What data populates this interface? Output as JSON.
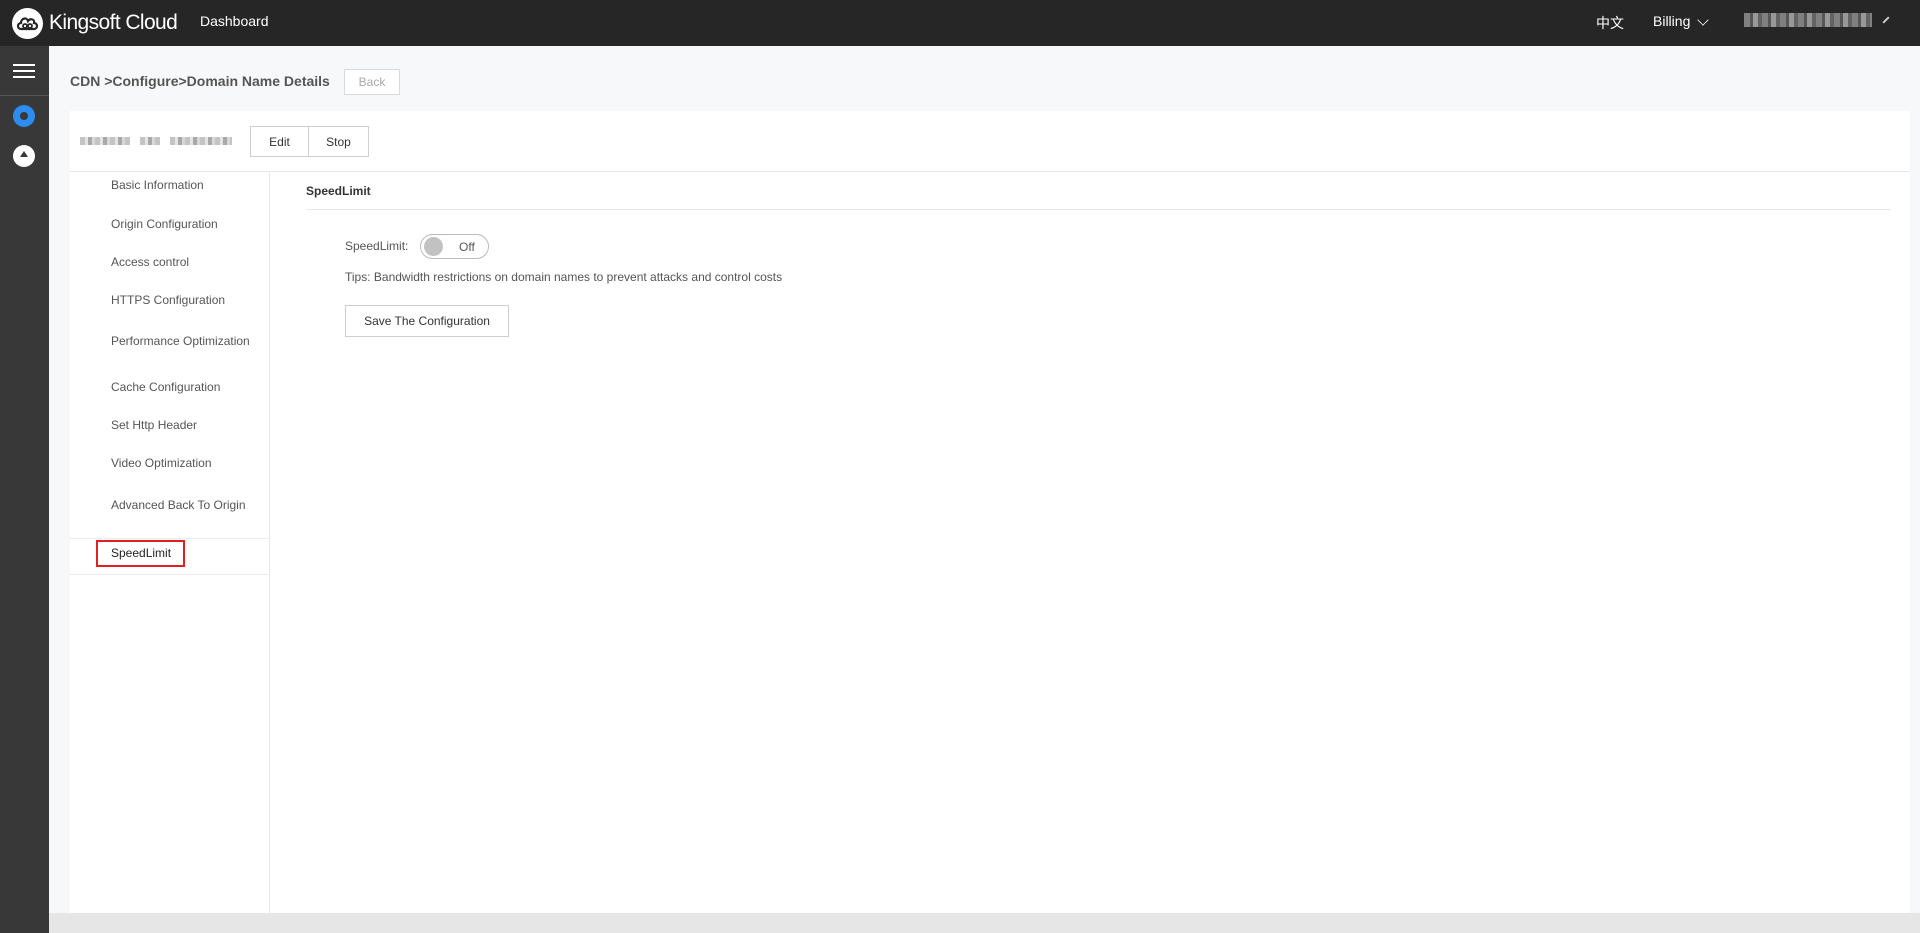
{
  "topbar": {
    "brand": "Kingsoft Cloud",
    "dashboard": "Dashboard",
    "language": "中文",
    "billing": "Billing"
  },
  "breadcrumb": "CDN >Configure>Domain Name Details",
  "back_label": "Back",
  "actions": {
    "edit_label": "Edit",
    "stop_label": "Stop"
  },
  "subnav": {
    "items": [
      "Basic Information",
      "Origin Configuration",
      "Access control",
      "HTTPS Configuration",
      "Performance Optimization",
      "Cache Configuration",
      "Set Http Header",
      "Video Optimization",
      "Advanced Back To Origin"
    ],
    "active": "SpeedLimit"
  },
  "main": {
    "section_title": "SpeedLimit",
    "speedlimit_label": "SpeedLimit:",
    "toggle_state": "Off",
    "tips": "Tips: Bandwidth restrictions on domain names to prevent attacks and control costs",
    "save_label": "Save The Configuration"
  },
  "colors": {
    "topbar": "#262626",
    "rail": "#383838",
    "active_icon": "#2d8cf0",
    "active_border": "#e02020"
  },
  "icons": {
    "logo": "kingsoft-cloud-logo",
    "menu": "menu-list-icon",
    "cdn": "cdn-icon",
    "upload": "cloud-upload-icon",
    "billing_chevron": "chevron-down-icon",
    "edit": "pencil-icon"
  }
}
